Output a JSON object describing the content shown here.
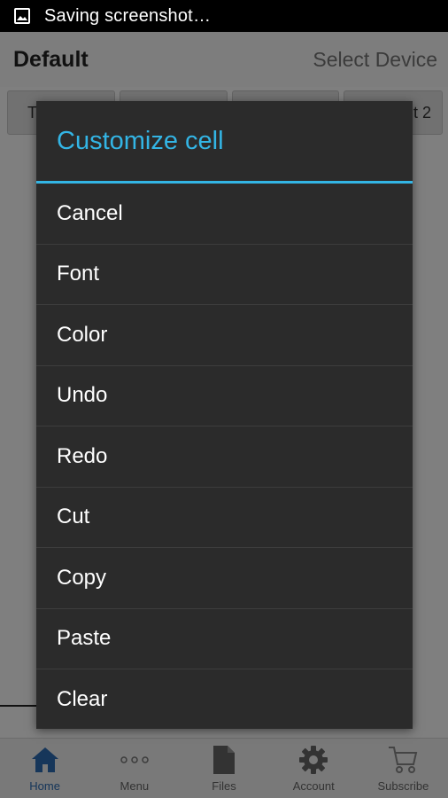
{
  "status_bar": {
    "text": "Saving screenshot…"
  },
  "app": {
    "title": "Default",
    "select_device": "Select Device",
    "tabs": [
      "T",
      "",
      "",
      "t 2"
    ]
  },
  "bottom_nav": [
    {
      "label": "Home",
      "icon": "home-icon",
      "active": true
    },
    {
      "label": "Menu",
      "icon": "more-dots-icon",
      "active": false
    },
    {
      "label": "Files",
      "icon": "file-icon",
      "active": false
    },
    {
      "label": "Account",
      "icon": "gear-icon",
      "active": false
    },
    {
      "label": "Subscribe",
      "icon": "cart-icon",
      "active": false
    }
  ],
  "dialog": {
    "title": "Customize cell",
    "items": [
      "Cancel",
      "Font",
      "Color",
      "Undo",
      "Redo",
      "Cut",
      "Copy",
      "Paste",
      "Clear"
    ]
  },
  "colors": {
    "accent": "#33b5e5",
    "dialog_bg": "#2b2b2b",
    "nav_active": "#2d6db5"
  }
}
